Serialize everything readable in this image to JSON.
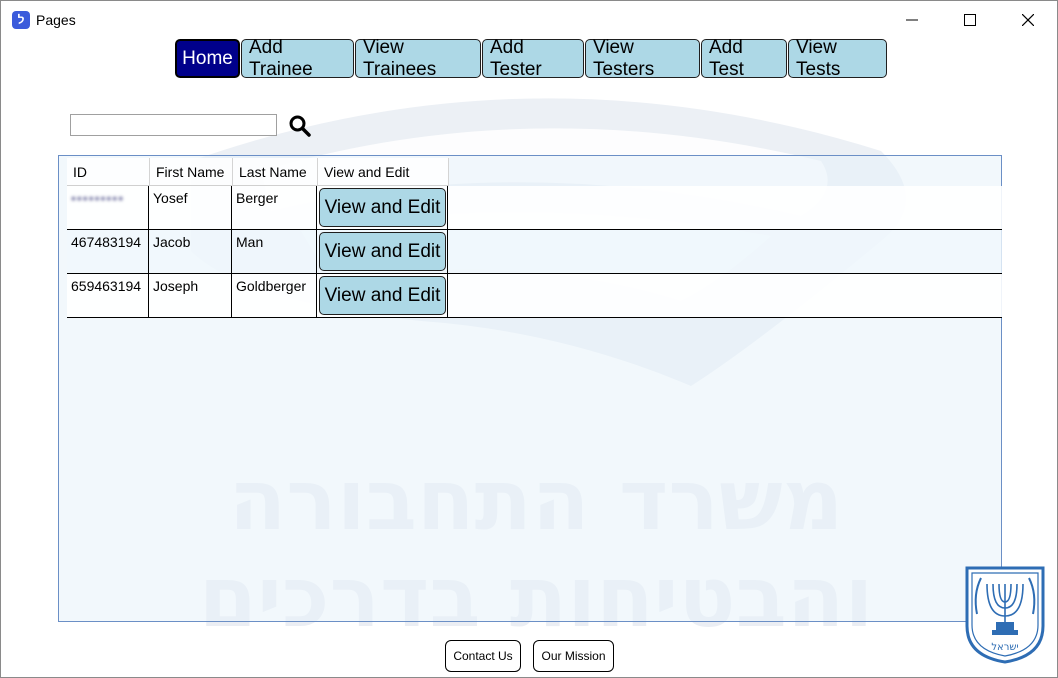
{
  "window": {
    "title": "Pages",
    "app_icon": "app-logo-icon"
  },
  "nav": {
    "items": [
      {
        "label": "Home",
        "active": true
      },
      {
        "label": "Add Trainee",
        "active": false
      },
      {
        "label": "View Trainees",
        "active": false
      },
      {
        "label": "Add Tester",
        "active": false
      },
      {
        "label": "View Testers",
        "active": false
      },
      {
        "label": "Add Test",
        "active": false
      },
      {
        "label": "View Tests",
        "active": false
      }
    ]
  },
  "search": {
    "value": "",
    "icon": "search-icon"
  },
  "table": {
    "columns": [
      "ID",
      "First Name",
      "Last Name",
      "View and Edit"
    ],
    "rows": [
      {
        "id": "•••••••••",
        "first_name": "Yosef",
        "last_name": "Berger",
        "action": "View and Edit"
      },
      {
        "id": "467483194",
        "first_name": "Jacob",
        "last_name": "Man",
        "action": "View and Edit"
      },
      {
        "id": "659463194",
        "first_name": "Joseph",
        "last_name": "Goldberger",
        "action": "View and Edit"
      }
    ]
  },
  "footer": {
    "contact_label": "Contact Us",
    "mission_label": "Our Mission"
  },
  "watermark": {
    "line1": "משרד התחבורה",
    "line2": "והבטיחות בדרכים"
  },
  "emblem": {
    "text": "ישראל"
  },
  "colors": {
    "nav_button": "#add8e6",
    "nav_active": "#00008b",
    "grid_border": "#6b8fc6"
  }
}
